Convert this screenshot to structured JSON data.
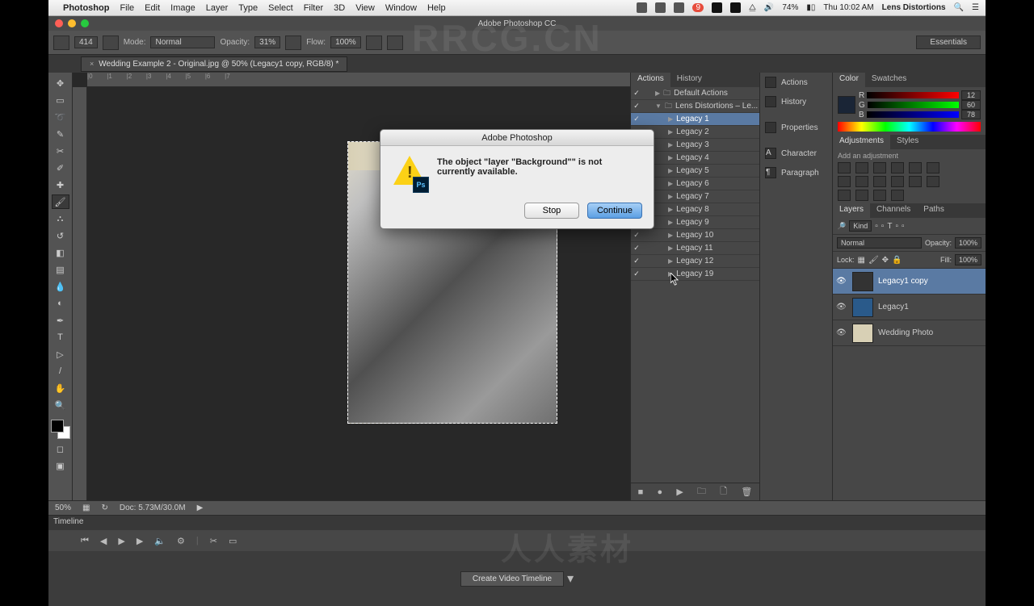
{
  "menubar": {
    "app": "Photoshop",
    "items": [
      "File",
      "Edit",
      "Image",
      "Layer",
      "Type",
      "Select",
      "Filter",
      "3D",
      "View",
      "Window",
      "Help"
    ],
    "battery": "74%",
    "clock": "Thu 10:02 AM",
    "right_app": "Lens Distortions",
    "notif_count": "9"
  },
  "app": {
    "title": "Adobe Photoshop CC",
    "doc_tab": "Wedding Example 2 - Original.jpg @ 50% (Legacy1 copy, RGB/8) *",
    "workspace": "Essentials"
  },
  "options_bar": {
    "brush_size": "414",
    "mode_label": "Mode:",
    "mode_value": "Normal",
    "opacity_label": "Opacity:",
    "opacity_value": "31%",
    "flow_label": "Flow:",
    "flow_value": "100%"
  },
  "status": {
    "zoom": "50%",
    "docsize": "Doc: 5.73M/30.0M"
  },
  "timeline": {
    "tab": "Timeline",
    "button": "Create Video Timeline"
  },
  "actions_panel": {
    "tabs": [
      "Actions",
      "History"
    ],
    "sets": [
      {
        "name": "Default Actions",
        "open": false
      },
      {
        "name": "Lens Distortions – Le...",
        "open": true
      }
    ],
    "items": [
      "Legacy 1",
      "Legacy 2",
      "Legacy 3",
      "Legacy 4",
      "Legacy 5",
      "Legacy 6",
      "Legacy 7",
      "Legacy 8",
      "Legacy 9",
      "Legacy 10",
      "Legacy 11",
      "Legacy 12",
      "Legacy 19"
    ]
  },
  "dock": {
    "items": [
      "Actions",
      "History",
      "Properties",
      "Character",
      "Paragraph"
    ]
  },
  "color_panel": {
    "tabs": [
      "Color",
      "Swatches"
    ],
    "r_label": "R",
    "r_value": "12",
    "g_label": "G",
    "g_value": "60",
    "b_label": "B",
    "b_value": "78"
  },
  "adjustments_panel": {
    "tabs": [
      "Adjustments",
      "Styles"
    ],
    "hint": "Add an adjustment"
  },
  "layers_panel": {
    "tabs": [
      "Layers",
      "Channels",
      "Paths"
    ],
    "filter_label": "Kind",
    "blend_mode": "Normal",
    "opacity_label": "Opacity:",
    "opacity_value": "100%",
    "lock_label": "Lock:",
    "fill_label": "Fill:",
    "fill_value": "100%",
    "layers": [
      {
        "name": "Legacy1 copy",
        "active": true
      },
      {
        "name": "Legacy1",
        "active": false
      },
      {
        "name": "Wedding Photo",
        "active": false
      }
    ]
  },
  "dialog": {
    "title": "Adobe Photoshop",
    "message": "The object \"layer \"Background\"\" is not currently available.",
    "stop": "Stop",
    "continue": "Continue"
  },
  "watermark": {
    "a": "RRCG.CN",
    "b": "人人素材"
  }
}
